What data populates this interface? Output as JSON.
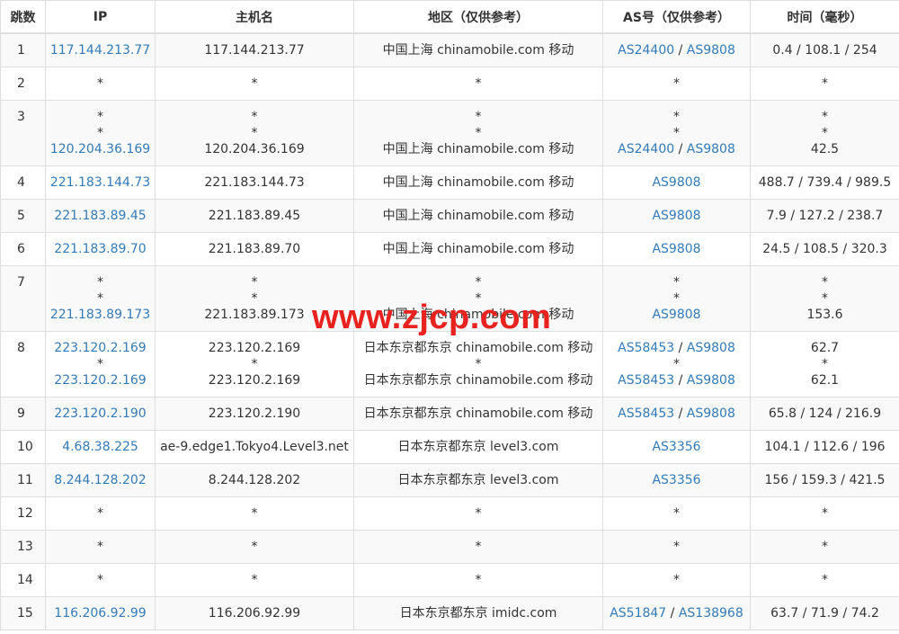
{
  "headers": [
    "跳数",
    "IP",
    "主机名",
    "地区（仅供参考）",
    "AS号（仅供参考）",
    "时间（毫秒）"
  ],
  "colors": {
    "link": "#337ab7",
    "watermark": "#e8231f",
    "stripe": "#f9f9f9",
    "border": "#dddddd"
  },
  "watermark": "www.zjcp.com",
  "rows": [
    {
      "hop": "1",
      "lines": [
        {
          "ip": "117.144.213.77",
          "host": "117.144.213.77",
          "region": "中国上海 chinamobile.com 移动",
          "as": [
            "AS24400",
            "AS9808"
          ],
          "time": "0.4 / 108.1 / 254"
        }
      ]
    },
    {
      "hop": "2",
      "lines": [
        {
          "ip": "*",
          "host": "*",
          "region": "*",
          "as": [],
          "as_text": "*",
          "time": "*"
        }
      ]
    },
    {
      "hop": "3",
      "lines": [
        {
          "ip": "*",
          "host": "*",
          "region": "*",
          "as": [],
          "as_text": "*",
          "time": "*"
        },
        {
          "ip": "*",
          "host": "*",
          "region": "*",
          "as": [],
          "as_text": "*",
          "time": "*"
        },
        {
          "ip": "120.204.36.169",
          "host": "120.204.36.169",
          "region": "中国上海 chinamobile.com 移动",
          "as": [
            "AS24400",
            "AS9808"
          ],
          "time": "42.5"
        }
      ]
    },
    {
      "hop": "4",
      "lines": [
        {
          "ip": "221.183.144.73",
          "host": "221.183.144.73",
          "region": "中国上海 chinamobile.com 移动",
          "as": [
            "AS9808"
          ],
          "time": "488.7 / 739.4 / 989.5"
        }
      ]
    },
    {
      "hop": "5",
      "lines": [
        {
          "ip": "221.183.89.45",
          "host": "221.183.89.45",
          "region": "中国上海 chinamobile.com 移动",
          "as": [
            "AS9808"
          ],
          "time": "7.9 / 127.2 / 238.7"
        }
      ]
    },
    {
      "hop": "6",
      "lines": [
        {
          "ip": "221.183.89.70",
          "host": "221.183.89.70",
          "region": "中国上海 chinamobile.com 移动",
          "as": [
            "AS9808"
          ],
          "time": "24.5 / 108.5 / 320.3"
        }
      ]
    },
    {
      "hop": "7",
      "lines": [
        {
          "ip": "*",
          "host": "*",
          "region": "*",
          "as": [],
          "as_text": "*",
          "time": "*"
        },
        {
          "ip": "*",
          "host": "*",
          "region": "*",
          "as": [],
          "as_text": "*",
          "time": "*"
        },
        {
          "ip": "221.183.89.173",
          "host": "221.183.89.173",
          "region": "中国上海 chinamobile.com 移动",
          "as": [
            "AS9808"
          ],
          "time": "153.6"
        }
      ]
    },
    {
      "hop": "8",
      "lines": [
        {
          "ip": "223.120.2.169",
          "host": "223.120.2.169",
          "region": "日本东京都东京 chinamobile.com 移动",
          "as": [
            "AS58453",
            "AS9808"
          ],
          "time": "62.7"
        },
        {
          "ip": "*",
          "host": "*",
          "region": "*",
          "as": [],
          "as_text": "*",
          "time": "*"
        },
        {
          "ip": "223.120.2.169",
          "host": "223.120.2.169",
          "region": "日本东京都东京 chinamobile.com 移动",
          "as": [
            "AS58453",
            "AS9808"
          ],
          "time": "62.1"
        }
      ]
    },
    {
      "hop": "9",
      "lines": [
        {
          "ip": "223.120.2.190",
          "host": "223.120.2.190",
          "region": "日本东京都东京 chinamobile.com 移动",
          "as": [
            "AS58453",
            "AS9808"
          ],
          "time": "65.8 / 124 / 216.9"
        }
      ]
    },
    {
      "hop": "10",
      "lines": [
        {
          "ip": "4.68.38.225",
          "host": "ae-9.edge1.Tokyo4.Level3.net",
          "region": "日本东京都东京 level3.com",
          "as": [
            "AS3356"
          ],
          "time": "104.1 / 112.6 / 196"
        }
      ]
    },
    {
      "hop": "11",
      "lines": [
        {
          "ip": "8.244.128.202",
          "host": "8.244.128.202",
          "region": "日本东京都东京 level3.com",
          "as": [
            "AS3356"
          ],
          "time": "156 / 159.3 / 421.5"
        }
      ]
    },
    {
      "hop": "12",
      "lines": [
        {
          "ip": "*",
          "host": "*",
          "region": "*",
          "as": [],
          "as_text": "*",
          "time": "*"
        }
      ]
    },
    {
      "hop": "13",
      "lines": [
        {
          "ip": "*",
          "host": "*",
          "region": "*",
          "as": [],
          "as_text": "*",
          "time": "*"
        }
      ]
    },
    {
      "hop": "14",
      "lines": [
        {
          "ip": "*",
          "host": "*",
          "region": "*",
          "as": [],
          "as_text": "*",
          "time": "*"
        }
      ]
    },
    {
      "hop": "15",
      "lines": [
        {
          "ip": "116.206.92.99",
          "host": "116.206.92.99",
          "region": "日本东京都东京 imidc.com",
          "as": [
            "AS51847",
            "AS138968"
          ],
          "time": "63.7 / 71.9 / 74.2"
        }
      ]
    }
  ]
}
